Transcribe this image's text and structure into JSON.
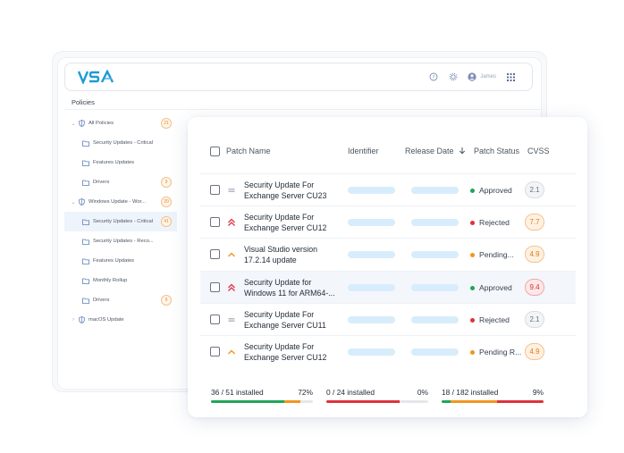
{
  "app": {
    "logo_text": "VSA",
    "user_name": "James"
  },
  "sidebar": {
    "title": "Policies",
    "items": [
      {
        "label": "All Policies",
        "level": 0,
        "expandable": true,
        "expanded": true,
        "icon": "shield-icon",
        "count": "21"
      },
      {
        "label": "Security Updates - Critical",
        "level": 1,
        "icon": "folder-icon"
      },
      {
        "label": "Features Updates",
        "level": 1,
        "icon": "folder-icon"
      },
      {
        "label": "Drivers",
        "level": 1,
        "icon": "folder-icon",
        "count": "9"
      },
      {
        "label": "Windows Update - Wor...",
        "level": 0,
        "expandable": true,
        "expanded": true,
        "icon": "shield-icon",
        "count": "20"
      },
      {
        "label": "Security Updates - Critical",
        "level": 1,
        "icon": "folder-open-icon",
        "count": "41",
        "selected": true
      },
      {
        "label": "Security Updates - Reco...",
        "level": 1,
        "icon": "folder-icon"
      },
      {
        "label": "Features Updates",
        "level": 1,
        "icon": "folder-icon"
      },
      {
        "label": "Monthly Rollup",
        "level": 1,
        "icon": "folder-icon"
      },
      {
        "label": "Drivers",
        "level": 1,
        "icon": "folder-icon",
        "count": "9"
      },
      {
        "label": "macOS Update",
        "level": 0,
        "expandable": true,
        "expanded": false,
        "icon": "shield-icon"
      }
    ]
  },
  "table": {
    "headers": {
      "patch_name": "Patch Name",
      "identifier": "Identifier",
      "release_date": "Release Date",
      "patch_status": "Patch Status",
      "cvss": "CVSS"
    },
    "rows": [
      {
        "name": "Security Update For Exchange Server CU23",
        "priority": "low",
        "status": "Approved",
        "status_color": "#22a55a",
        "cvss": "2.1",
        "cvss_level": "low"
      },
      {
        "name": "Security Update For Exchange Server CU12",
        "priority": "high",
        "status": "Rejected",
        "status_color": "#e0323c",
        "cvss": "7.7",
        "cvss_level": "medium"
      },
      {
        "name": "Visual Studio version 17.2.14 update",
        "priority": "medium",
        "status": "Pending...",
        "status_color": "#f0961e",
        "cvss": "4.9",
        "cvss_level": "medium"
      },
      {
        "name": "Security Update for Windows 11 for ARM64-...",
        "priority": "high",
        "status": "Approved",
        "status_color": "#22a55a",
        "cvss": "9.4",
        "cvss_level": "high",
        "highlight": true
      },
      {
        "name": "Security Update For Exchange Server CU11",
        "priority": "low",
        "status": "Rejected",
        "status_color": "#e0323c",
        "cvss": "2.1",
        "cvss_level": "low"
      },
      {
        "name": "Security Update For Exchange Server CU12",
        "priority": "medium",
        "status": "Pending R...",
        "status_color": "#f0961e",
        "cvss": "4.9",
        "cvss_level": "medium"
      }
    ]
  },
  "footer": [
    {
      "label": "36 / 51 installed",
      "percent": "72%",
      "fill": 0.72,
      "color": "#22a55a",
      "rest_color": "#f0961e"
    },
    {
      "label": "0 / 24 installed",
      "percent": "0%",
      "fill": 0.0,
      "color": "#22a55a",
      "rest_color": "#e0323c"
    },
    {
      "label": "18 / 182 installed",
      "percent": "9%",
      "fill": 0.09,
      "color": "#22a55a",
      "rest_color": "#f0961e",
      "rest_color2": "#e0323c"
    }
  ],
  "colors": {
    "brand": "#1d9bd6",
    "cvss_low_bg": "#f3f4f6",
    "cvss_medium_bg": "#fff1e2",
    "cvss_high_bg": "#fde8e8"
  }
}
